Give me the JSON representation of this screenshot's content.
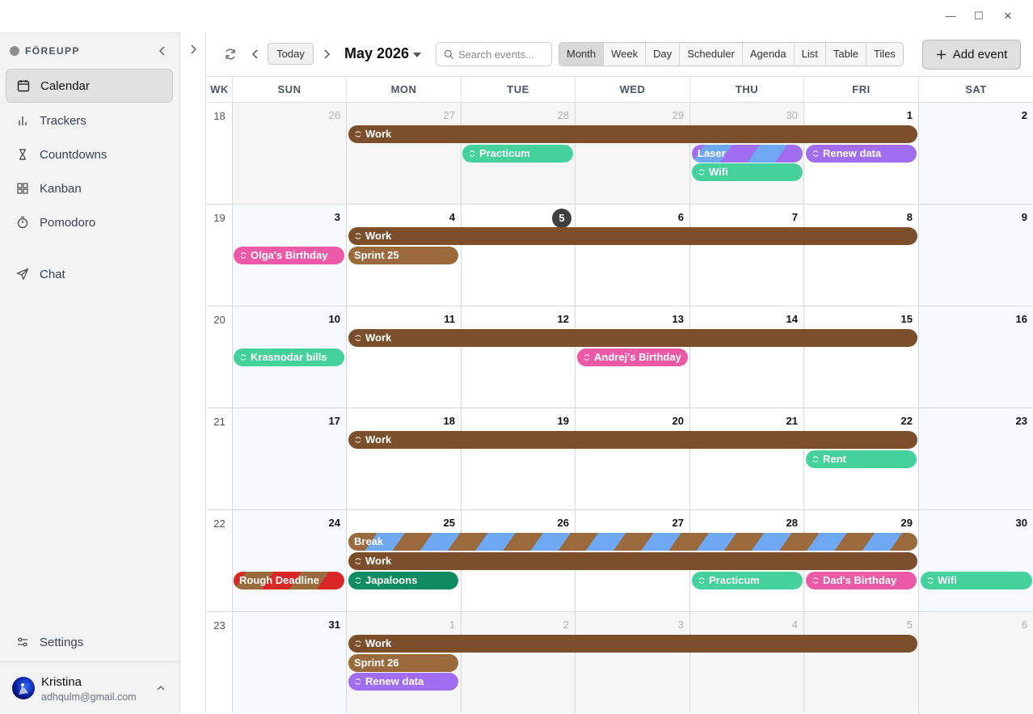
{
  "window": {
    "minimize": "—",
    "maximize": "☐",
    "close": "✕"
  },
  "sidebar": {
    "brand": "FÖREUPP",
    "items": [
      {
        "label": "Calendar",
        "icon": "calendar-icon",
        "active": true
      },
      {
        "label": "Trackers",
        "icon": "bar-chart-icon"
      },
      {
        "label": "Countdowns",
        "icon": "hourglass-icon"
      },
      {
        "label": "Kanban",
        "icon": "grid-icon"
      },
      {
        "label": "Pomodoro",
        "icon": "timer-icon"
      },
      {
        "label": "Chat",
        "icon": "send-icon"
      },
      {
        "label": "Settings",
        "icon": "sliders-icon"
      }
    ],
    "user": {
      "name": "Kristina",
      "email": "adhqulm@gmail.com"
    }
  },
  "toolbar": {
    "today": "Today",
    "month": "May 2026",
    "search_placeholder": "Search events...",
    "views": [
      "Month",
      "Week",
      "Day",
      "Scheduler",
      "Agenda",
      "List",
      "Table",
      "Tiles"
    ],
    "active_view": "Month",
    "add": "Add event"
  },
  "calendar": {
    "headers": [
      "WK",
      "SUN",
      "MON",
      "TUE",
      "WED",
      "THU",
      "FRI",
      "SAT"
    ],
    "weeks": [
      {
        "wk": "18",
        "days": [
          "26",
          "27",
          "28",
          "29",
          "30",
          "1",
          "2"
        ]
      },
      {
        "wk": "19",
        "days": [
          "3",
          "4",
          "5",
          "6",
          "7",
          "8",
          "9"
        ]
      },
      {
        "wk": "20",
        "days": [
          "10",
          "11",
          "12",
          "13",
          "14",
          "15",
          "16"
        ]
      },
      {
        "wk": "21",
        "days": [
          "17",
          "18",
          "19",
          "20",
          "21",
          "22",
          "23"
        ]
      },
      {
        "wk": "22",
        "days": [
          "24",
          "25",
          "26",
          "27",
          "28",
          "29",
          "30"
        ]
      },
      {
        "wk": "23",
        "days": [
          "31",
          "1",
          "2",
          "3",
          "4",
          "5",
          "6"
        ]
      }
    ],
    "today_label": "5",
    "colors": {
      "work": "#7b4f2c",
      "sprint": "#9b6a3c",
      "green": "#44d19c",
      "purple": "#a06cf0",
      "pink": "#ec5aa7",
      "teal": "#0f8c62",
      "blue": "#6ea8f0",
      "red": "#d92626"
    },
    "events": {
      "w1_work": "Work",
      "w1_practicum": "Practicum",
      "w1_laser": "Laser",
      "w1_wifi": "Wifi",
      "w1_renew": "Renew data",
      "w2_work": "Work",
      "w2_olga": "Olga's Birthday",
      "w2_sprint": "Sprint 25",
      "w3_work": "Work",
      "w3_krasnodar": "Krasnodar bills",
      "w3_andrej": "Andrej's Birthday",
      "w4_work": "Work",
      "w4_rent": "Rent",
      "w5_break": "Break",
      "w5_work": "Work",
      "w5_rough": "Rough Deadline",
      "w5_japaloons": "Japaloons",
      "w5_practicum": "Practicum",
      "w5_dad": "Dad's Birthday",
      "w5_wifi": "Wifi",
      "w6_work": "Work",
      "w6_sprint": "Sprint 26",
      "w6_renew": "Renew data"
    }
  }
}
